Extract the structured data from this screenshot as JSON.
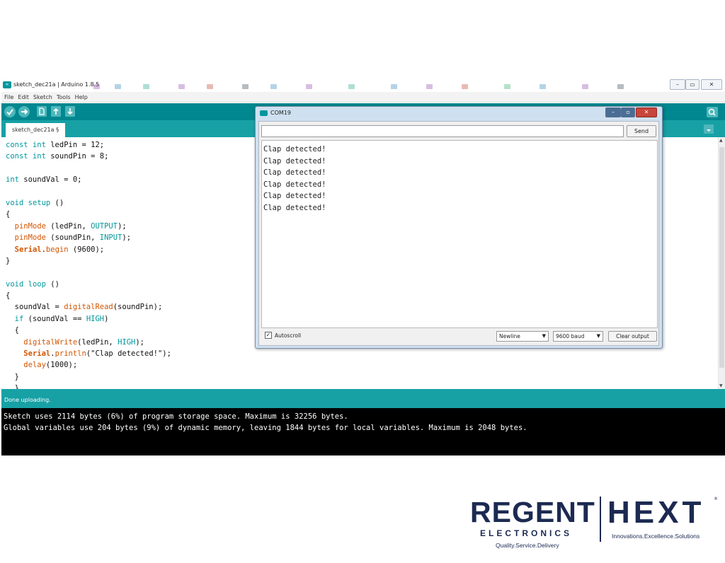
{
  "ide": {
    "window_title": "sketch_dec21a | Arduino 1.8.5",
    "window_buttons": {
      "minimize": "–",
      "restore": "▭",
      "close": "✕"
    },
    "menu": [
      "File",
      "Edit",
      "Sketch",
      "Tools",
      "Help"
    ],
    "toolbar": {
      "verify_icon": "check-icon",
      "upload_icon": "arrow-right-icon",
      "new_icon": "file-icon",
      "open_icon": "arrow-up-icon",
      "save_icon": "arrow-down-icon",
      "serial_monitor_icon": "magnifier-icon"
    },
    "tab": {
      "label": "sketch_dec21a §"
    },
    "colors": {
      "toolbar": "#00878f",
      "tabbar": "#17a1a5",
      "keyword": "#00979c",
      "function": "#d35400"
    },
    "code": [
      [
        {
          "t": "const int",
          "c": "kw"
        },
        {
          "t": " ledPin = 12;"
        }
      ],
      [
        {
          "t": "const int",
          "c": "kw"
        },
        {
          "t": " soundPin = 8;"
        }
      ],
      [],
      [
        {
          "t": "int",
          "c": "kw"
        },
        {
          "t": " soundVal = 0;"
        }
      ],
      [],
      [
        {
          "t": "void",
          "c": "kw"
        },
        {
          "t": " "
        },
        {
          "t": "setup",
          "c": "kw"
        },
        {
          "t": " ()"
        }
      ],
      [
        {
          "t": "{"
        }
      ],
      [
        {
          "t": "  "
        },
        {
          "t": "pinMode",
          "c": "fn"
        },
        {
          "t": " (ledPin, "
        },
        {
          "t": "OUTPUT",
          "c": "ct"
        },
        {
          "t": ");"
        }
      ],
      [
        {
          "t": "  "
        },
        {
          "t": "pinMode",
          "c": "fn"
        },
        {
          "t": " (soundPin, "
        },
        {
          "t": "INPUT",
          "c": "ct"
        },
        {
          "t": ");"
        }
      ],
      [
        {
          "t": "  "
        },
        {
          "t": "Serial",
          "c": "ob"
        },
        {
          "t": "."
        },
        {
          "t": "begin",
          "c": "fn"
        },
        {
          "t": " (9600);"
        }
      ],
      [
        {
          "t": "}"
        }
      ],
      [],
      [
        {
          "t": "void",
          "c": "kw"
        },
        {
          "t": " "
        },
        {
          "t": "loop",
          "c": "kw"
        },
        {
          "t": " ()"
        }
      ],
      [
        {
          "t": "{"
        }
      ],
      [
        {
          "t": "  soundVal = "
        },
        {
          "t": "digitalRead",
          "c": "fn"
        },
        {
          "t": "(soundPin);"
        }
      ],
      [
        {
          "t": "  "
        },
        {
          "t": "if",
          "c": "kw"
        },
        {
          "t": " (soundVal == "
        },
        {
          "t": "HIGH",
          "c": "ct"
        },
        {
          "t": ")"
        }
      ],
      [
        {
          "t": "  {"
        }
      ],
      [
        {
          "t": "    "
        },
        {
          "t": "digitalWrite",
          "c": "fn"
        },
        {
          "t": "(ledPin, "
        },
        {
          "t": "HIGH",
          "c": "ct"
        },
        {
          "t": ");"
        }
      ],
      [
        {
          "t": "    "
        },
        {
          "t": "Serial",
          "c": "ob"
        },
        {
          "t": "."
        },
        {
          "t": "println",
          "c": "fn"
        },
        {
          "t": "(\"Clap detected!\");"
        }
      ],
      [
        {
          "t": "    "
        },
        {
          "t": "delay",
          "c": "fn"
        },
        {
          "t": "(1000);"
        }
      ],
      [
        {
          "t": "  }"
        }
      ],
      [
        {
          "t": "  }"
        }
      ]
    ],
    "status": "Done uploading.",
    "console": [
      "Sketch uses 2114 bytes (6%) of program storage space. Maximum is 32256 bytes.",
      "Global variables use 204 bytes (9%) of dynamic memory, leaving 1844 bytes for local variables. Maximum is 2048 bytes."
    ]
  },
  "serial_monitor": {
    "title": "COM19",
    "window_buttons": {
      "minimize": "–",
      "maximize": "▫",
      "close": "✕"
    },
    "input_value": "",
    "send_label": "Send",
    "output": [
      "Clap detected!",
      "Clap detected!",
      "Clap detected!",
      "Clap detected!",
      "Clap detected!",
      "Clap detected!"
    ],
    "autoscroll_label": "Autoscroll",
    "autoscroll_checked": true,
    "line_ending": "Newline",
    "baud": "9600 baud",
    "clear_label": "Clear output"
  },
  "branding": {
    "regent_name": "REGENT",
    "regent_sub": "ELECTRONICS",
    "regent_tagline": "Quality.Service.Delivery",
    "hext_name": "HEXT",
    "hext_mark": "®",
    "hext_tagline": "Innovations.Excellence.Solutions",
    "color": "#1c2a52"
  }
}
